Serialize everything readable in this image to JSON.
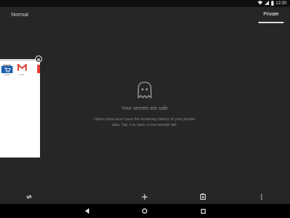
{
  "status_bar": {
    "time": "12:30",
    "icons": [
      "wifi-icon",
      "signal-icon",
      "battery-icon"
    ]
  },
  "tabs": {
    "normal_label": "Normal",
    "private_label": "Private",
    "active": "Private"
  },
  "tab_card": {
    "speed_dial": [
      {
        "label": "Amazon",
        "brand_text": "amazon",
        "icon": "shopping-cart-icon",
        "color": "#1b5fad"
      },
      {
        "label": "Gmail",
        "icon": "gmail-icon",
        "color": "#d93025"
      }
    ]
  },
  "empty_state": {
    "icon": "ghost-icon",
    "title": "Your secrets are safe",
    "description": "Opera beta won't save the browsing history of your private tabs. Tap + to open a new private tab."
  },
  "bottom_toolbar": {
    "icons": [
      "sync-icon",
      "add-tab-icon",
      "tab-trash-icon",
      "more-vert-icon"
    ]
  },
  "nav_bar": {
    "icons": [
      "back-icon",
      "home-icon",
      "recents-icon"
    ]
  },
  "colors": {
    "background": "#262626",
    "status_bar": "#101010",
    "nav_bar": "#000000",
    "text_muted": "#8e8e8e"
  }
}
